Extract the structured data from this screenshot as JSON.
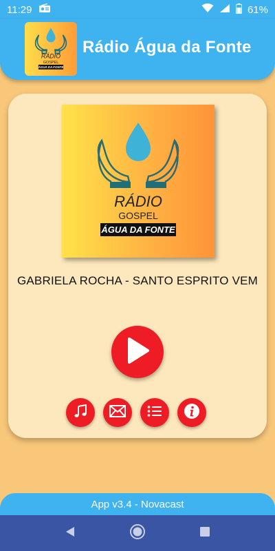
{
  "status_bar": {
    "time": "11:29",
    "battery_percent": "61%",
    "icons": [
      "radio-icon",
      "wifi-icon",
      "signal-icon",
      "battery-icon"
    ]
  },
  "header": {
    "title": "Rádio Água da Fonte"
  },
  "logo": {
    "line1": "RÁDIO",
    "line2": "GOSPEL",
    "line3": "ÁGUA DA FONTE"
  },
  "player": {
    "song_title": "GABRIELA ROCHA - SANTO ESPRITO VEM"
  },
  "actions": [
    {
      "name": "music-note-icon"
    },
    {
      "name": "mail-icon"
    },
    {
      "name": "list-icon"
    },
    {
      "name": "info-icon"
    }
  ],
  "footer": {
    "version_text": "App v3.4 - Novacast"
  },
  "colors": {
    "primary": "#3eb3f0",
    "background": "#f8c77a",
    "card": "#fde7bc",
    "accent": "#ee1c25",
    "nav": "#3a55a4"
  }
}
